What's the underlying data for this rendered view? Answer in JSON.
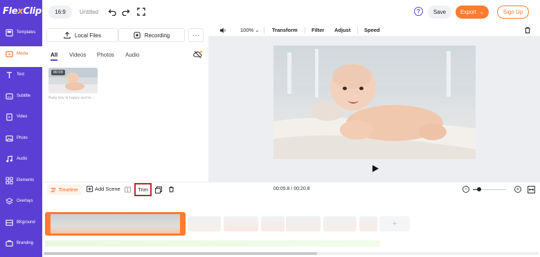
{
  "app": {
    "logo_text": "FlexClip",
    "logo_text_a": "Fle",
    "logo_text_b": "x",
    "logo_text_c": "Clip"
  },
  "sidebar": {
    "items": [
      {
        "label": "Templates",
        "icon": "templates-icon"
      },
      {
        "label": "Media",
        "icon": "media-icon",
        "active": true
      },
      {
        "label": "Text",
        "icon": "text-icon"
      },
      {
        "label": "Subtitle",
        "icon": "subtitle-icon"
      },
      {
        "label": "Video",
        "icon": "video-icon"
      },
      {
        "label": "Photo",
        "icon": "photo-icon"
      },
      {
        "label": "Audio",
        "icon": "audio-icon"
      },
      {
        "label": "Elements",
        "icon": "elements-icon"
      },
      {
        "label": "Overlays",
        "icon": "overlays-icon"
      },
      {
        "label": "BKground",
        "icon": "background-icon"
      },
      {
        "label": "Branding",
        "icon": "branding-icon"
      }
    ]
  },
  "topbar": {
    "aspect_ratio": "16:9",
    "title": "Untitled",
    "help": "?",
    "save_label": "Save",
    "export_label": "Export",
    "signup_label": "Sign Up"
  },
  "media_panel": {
    "local_files_label": "Local Files",
    "recording_label": "Recording",
    "more_label": "···",
    "tabs": [
      {
        "label": "All",
        "active": true
      },
      {
        "label": "Videos"
      },
      {
        "label": "Photos"
      },
      {
        "label": "Audio"
      }
    ],
    "items": [
      {
        "duration": "00:09",
        "caption": "Baby boy is happy and la..."
      }
    ]
  },
  "preview_toolbar": {
    "zoom": "100%",
    "transform_label": "Transform",
    "filter_label": "Filter",
    "adjust_label": "Adjust",
    "speed_label": "Speed"
  },
  "timeline": {
    "timeline_label": "Timeline",
    "add_scene_label": "Add Scene",
    "trim_label": "Trim",
    "time_readout": "00:05.8 / 00:20.8",
    "zoom_level": 0.18
  },
  "colors": {
    "brand_purple": "#5b3fd4",
    "accent_orange": "#ff7b2e",
    "trim_highlight": "#b3262b"
  }
}
